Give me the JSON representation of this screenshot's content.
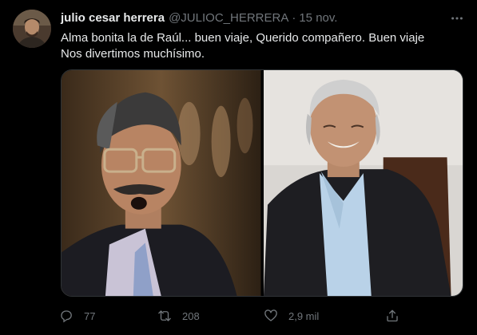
{
  "author": {
    "display_name": "julio cesar herrera",
    "handle": "@JULIOC_HERRERA",
    "separator": "·",
    "time": "15 nov."
  },
  "tweet": {
    "line1": "Alma bonita la de Raúl... buen viaje, Querido compañero.  Buen viaje",
    "line2": "Nos divertimos muchísimo."
  },
  "actions": {
    "reply_count": "77",
    "retweet_count": "208",
    "like_count": "2,9 mil"
  },
  "icons": {
    "more": "more-dots-icon",
    "reply": "reply-icon",
    "retweet": "retweet-icon",
    "like": "heart-icon",
    "share": "share-icon"
  },
  "colors": {
    "background": "#000000",
    "text": "#e7e9ea",
    "muted": "#71767b"
  }
}
